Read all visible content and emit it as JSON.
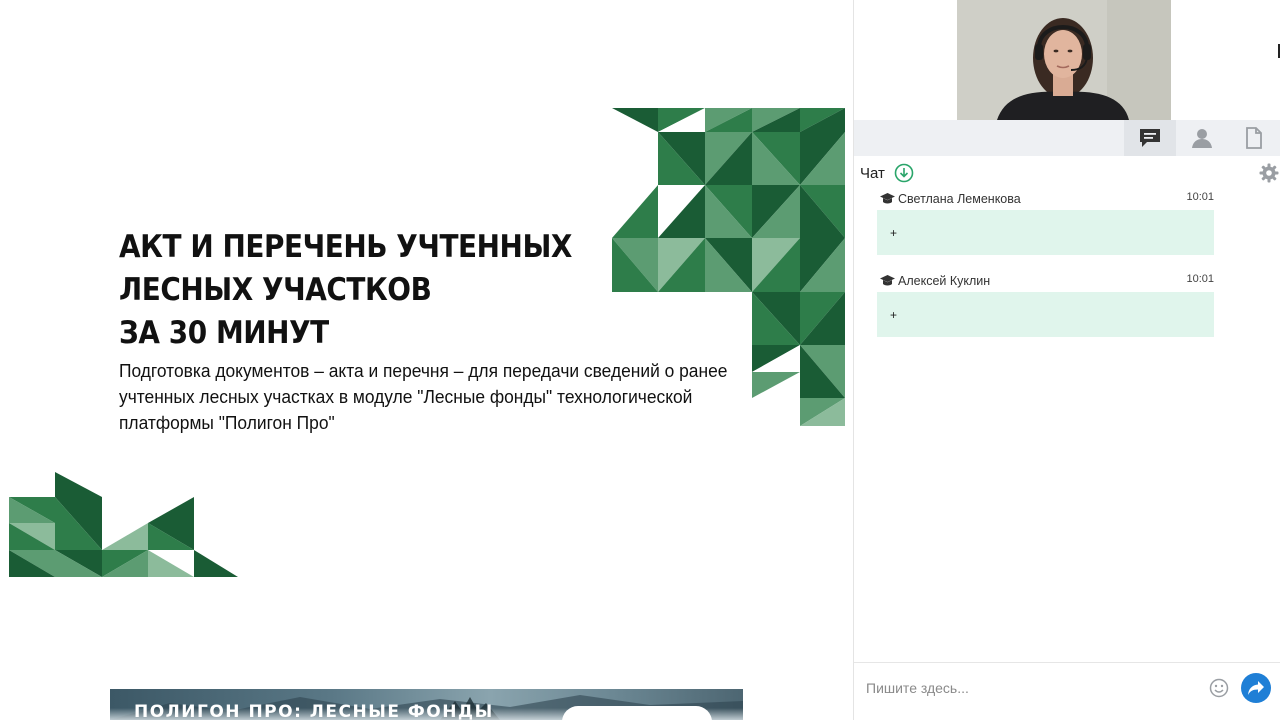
{
  "slide": {
    "title_lines": [
      "АКТ И ПЕРЕЧЕНЬ УЧТЕННЫХ",
      "ЛЕСНЫХ УЧАСТКОВ",
      "ЗА 30 МИНУТ"
    ],
    "subtitle_lines": [
      "Подготовка документов – акта и перечня – для передачи сведений о ранее",
      "учтенных лесных участках в модуле \"Лесные фонды\" технологической",
      "платформы \"Полигон Про\""
    ],
    "banner_text": "ПОЛИГОН ПРО: ЛЕСНЫЕ ФОНДЫ",
    "palette": [
      "#1a5c35",
      "#2e7d4a",
      "#5c9c72",
      "#8cbb9b"
    ]
  },
  "sidebar": {
    "tabs": [
      {
        "label": "chat",
        "icon": "chat-icon",
        "active": true
      },
      {
        "label": "participants",
        "icon": "user-icon",
        "active": false
      },
      {
        "label": "files",
        "icon": "file-icon",
        "active": false
      }
    ],
    "chat": {
      "title": "Чат",
      "messages": [
        {
          "author": "Светлана Леменкова",
          "time": "10:01",
          "text": "+"
        },
        {
          "author": "Алексей Куклин",
          "time": "10:01",
          "text": "+"
        }
      ],
      "input_placeholder": "Пишите здесь...",
      "bubble_color": "#e0f5ec",
      "accent_color": "#1f7fd6",
      "download_color": "#2aa56a"
    }
  }
}
